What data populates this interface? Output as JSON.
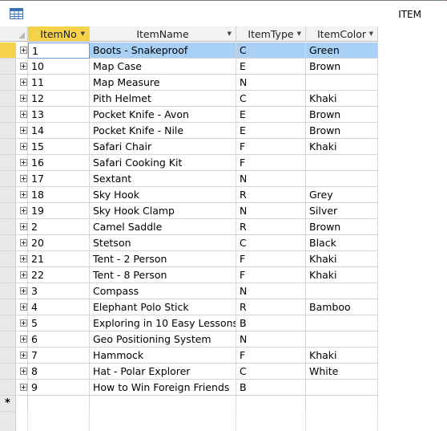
{
  "window": {
    "title": "ITEM",
    "icon": "table-icon"
  },
  "table": {
    "columns": [
      {
        "label": "ItemNo",
        "selected": true
      },
      {
        "label": "ItemName",
        "selected": false
      },
      {
        "label": "ItemType",
        "selected": false
      },
      {
        "label": "ItemColor",
        "selected": false
      }
    ],
    "rows": [
      {
        "no": "1",
        "name": "Boots - Snakeproof",
        "type": "C",
        "color": "Green"
      },
      {
        "no": "10",
        "name": "Map Case",
        "type": "E",
        "color": "Brown"
      },
      {
        "no": "11",
        "name": "Map Measure",
        "type": "N",
        "color": ""
      },
      {
        "no": "12",
        "name": "Pith Helmet",
        "type": "C",
        "color": "Khaki"
      },
      {
        "no": "13",
        "name": "Pocket Knife - Avon",
        "type": "E",
        "color": "Brown"
      },
      {
        "no": "14",
        "name": "Pocket Knife - Nile",
        "type": "E",
        "color": "Brown"
      },
      {
        "no": "15",
        "name": "Safari Chair",
        "type": "F",
        "color": "Khaki"
      },
      {
        "no": "16",
        "name": "Safari Cooking Kit",
        "type": "F",
        "color": ""
      },
      {
        "no": "17",
        "name": "Sextant",
        "type": "N",
        "color": ""
      },
      {
        "no": "18",
        "name": "Sky Hook",
        "type": "R",
        "color": "Grey"
      },
      {
        "no": "19",
        "name": "Sky Hook Clamp",
        "type": "N",
        "color": "Silver"
      },
      {
        "no": "2",
        "name": "Camel Saddle",
        "type": "R",
        "color": "Brown"
      },
      {
        "no": "20",
        "name": "Stetson",
        "type": "C",
        "color": "Black"
      },
      {
        "no": "21",
        "name": "Tent - 2 Person",
        "type": "F",
        "color": "Khaki"
      },
      {
        "no": "22",
        "name": "Tent - 8 Person",
        "type": "F",
        "color": "Khaki"
      },
      {
        "no": "3",
        "name": "Compass",
        "type": "N",
        "color": ""
      },
      {
        "no": "4",
        "name": "Elephant Polo Stick",
        "type": "R",
        "color": "Bamboo"
      },
      {
        "no": "5",
        "name": "Exploring in 10 Easy Lessons",
        "type": "B",
        "color": ""
      },
      {
        "no": "6",
        "name": "Geo Positioning System",
        "type": "N",
        "color": ""
      },
      {
        "no": "7",
        "name": "Hammock",
        "type": "F",
        "color": "Khaki"
      },
      {
        "no": "8",
        "name": "Hat - Polar Explorer",
        "type": "C",
        "color": "White"
      },
      {
        "no": "9",
        "name": "How to Win Foreign Friends",
        "type": "B",
        "color": ""
      }
    ],
    "new_row_marker": "*"
  },
  "colors": {
    "selected_header": "#f6d24a",
    "selected_row": "#a8d0f5"
  }
}
